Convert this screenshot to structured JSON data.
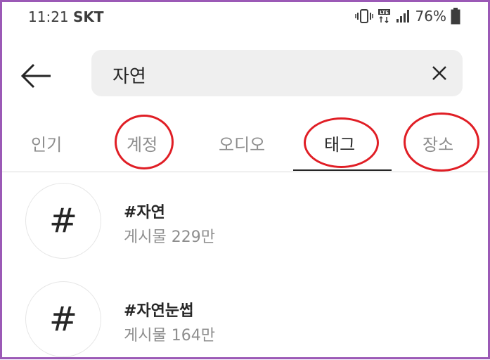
{
  "status_bar": {
    "time": "11:21",
    "carrier": "SKT",
    "network": "LTE",
    "battery": "76%"
  },
  "search": {
    "query": "자연"
  },
  "tabs": [
    {
      "label": "인기",
      "active": false,
      "circled": false
    },
    {
      "label": "계정",
      "active": false,
      "circled": true
    },
    {
      "label": "오디오",
      "active": false,
      "circled": false
    },
    {
      "label": "태그",
      "active": true,
      "circled": true
    },
    {
      "label": "장소",
      "active": false,
      "circled": true
    }
  ],
  "results": [
    {
      "icon": "#",
      "name": "#자연",
      "meta": "게시물 229만"
    },
    {
      "icon": "#",
      "name": "#자연눈썹",
      "meta": "게시물 164만"
    }
  ],
  "colors": {
    "annotation": "#e01e25",
    "frame": "#9b59b6"
  }
}
